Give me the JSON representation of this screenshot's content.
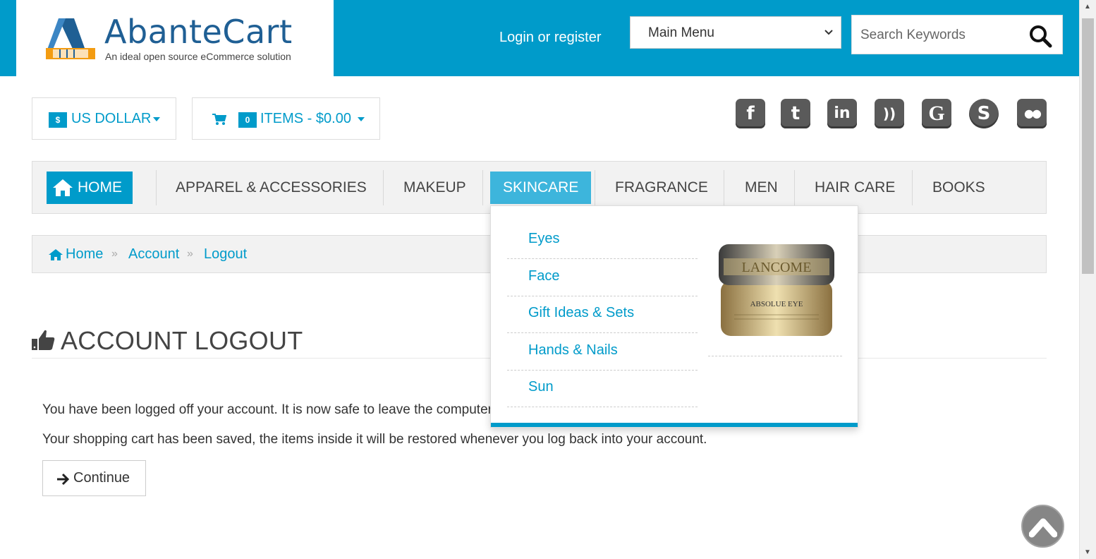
{
  "header": {
    "logo_name": "AbanteCart",
    "logo_tagline": "An ideal open source eCommerce solution",
    "login_link": "Login or register",
    "main_menu_value": "Main Menu",
    "search_placeholder": "Search Keywords"
  },
  "toolbar": {
    "currency_symbol": "$",
    "currency_label": "US DOLLAR",
    "cart_count": "0",
    "cart_label": "ITEMS - $0.00"
  },
  "social": [
    {
      "icon": "facebook-icon",
      "glyph": "f"
    },
    {
      "icon": "twitter-icon",
      "glyph": "t"
    },
    {
      "icon": "linkedin-icon",
      "glyph": "in"
    },
    {
      "icon": "rss-icon",
      "glyph": "))"
    },
    {
      "icon": "google-icon",
      "glyph": "G"
    },
    {
      "icon": "skype-icon",
      "glyph": "S"
    },
    {
      "icon": "flickr-icon",
      "glyph": "●●"
    }
  ],
  "nav": {
    "items": [
      {
        "label": "HOME"
      },
      {
        "label": "APPAREL & ACCESSORIES"
      },
      {
        "label": "MAKEUP"
      },
      {
        "label": "SKINCARE"
      },
      {
        "label": "FRAGRANCE"
      },
      {
        "label": "MEN"
      },
      {
        "label": "HAIR CARE"
      },
      {
        "label": "BOOKS"
      }
    ],
    "active": "SKINCARE"
  },
  "dropdown": {
    "items": [
      "Eyes",
      "Face",
      "Gift Ideas & Sets",
      "Hands & Nails",
      "Sun"
    ],
    "product_brand": "LANCOME",
    "product_name": "ABSOLUE EYE"
  },
  "breadcrumb": [
    "Home",
    "Account",
    "Logout"
  ],
  "page": {
    "title": "ACCOUNT LOGOUT",
    "message1": "You have been logged off your account. It is now safe to leave the computer.",
    "message2": "Your shopping cart has been saved, the items inside it will be restored whenever you log back into your account.",
    "continue_label": "Continue"
  },
  "colors": {
    "brand": "#009bca",
    "nav_active": "#3db5dc"
  }
}
